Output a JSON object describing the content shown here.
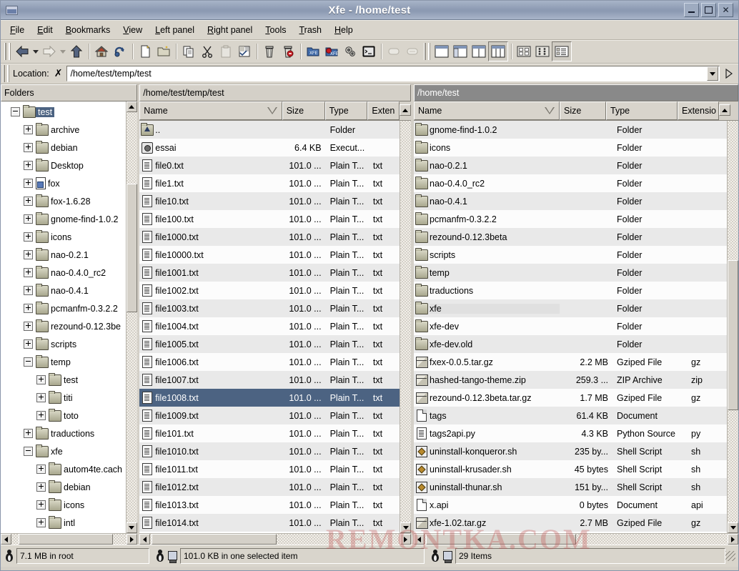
{
  "window": {
    "title": "Xfe - /home/test",
    "app_icon": "xfe-window-icon",
    "minimize_label": "_",
    "maximize_label": "□",
    "close_label": "✕"
  },
  "menubar": {
    "items": [
      {
        "label": "File",
        "accel": "F"
      },
      {
        "label": "Edit",
        "accel": "E"
      },
      {
        "label": "Bookmarks",
        "accel": "B"
      },
      {
        "label": "View",
        "accel": "V"
      },
      {
        "label": "Left panel",
        "accel": "L"
      },
      {
        "label": "Right panel",
        "accel": "R"
      },
      {
        "label": "Tools",
        "accel": "T"
      },
      {
        "label": "Trash",
        "accel": "T"
      },
      {
        "label": "Help",
        "accel": "H"
      }
    ]
  },
  "toolbar": {
    "groups": [
      {
        "buttons": [
          {
            "name": "back-icon",
            "tip": "Back"
          },
          {
            "name": "back-history-dropdown-icon",
            "tip": "Back history"
          },
          {
            "name": "forward-icon",
            "tip": "Forward"
          },
          {
            "name": "forward-history-dropdown-icon",
            "tip": "Forward history"
          },
          {
            "name": "up-icon",
            "tip": "Go up one level"
          }
        ]
      },
      {
        "buttons": [
          {
            "name": "home-icon",
            "tip": "Go home"
          },
          {
            "name": "refresh-icon",
            "tip": "Refresh"
          }
        ]
      },
      {
        "buttons": [
          {
            "name": "new-file-icon",
            "tip": "New file"
          },
          {
            "name": "new-folder-icon",
            "tip": "New folder"
          }
        ]
      },
      {
        "buttons": [
          {
            "name": "copy-icon",
            "tip": "Copy"
          },
          {
            "name": "cut-icon",
            "tip": "Cut"
          },
          {
            "name": "paste-icon",
            "tip": "Paste"
          },
          {
            "name": "properties-icon",
            "tip": "Properties"
          }
        ]
      },
      {
        "buttons": [
          {
            "name": "trash-icon",
            "tip": "Move to trash"
          },
          {
            "name": "delete-icon",
            "tip": "Delete"
          }
        ]
      },
      {
        "buttons": [
          {
            "name": "mount-icon",
            "tip": "Mount"
          },
          {
            "name": "unmount-icon",
            "tip": "Unmount"
          },
          {
            "name": "preferences-icon",
            "tip": "Preferences"
          },
          {
            "name": "terminal-icon",
            "tip": "Open terminal"
          }
        ]
      },
      {
        "buttons": [
          {
            "name": "hidden-files-icon",
            "tip": "Show hidden files"
          },
          {
            "name": "thumbnails-icon",
            "tip": "Show thumbnails"
          }
        ]
      },
      {
        "buttons": [
          {
            "name": "one-panel-icon",
            "tip": "One panel",
            "selected": false
          },
          {
            "name": "tree-and-panel-icon",
            "tip": "Tree and panel",
            "selected": false
          },
          {
            "name": "two-panels-icon",
            "tip": "Two panels",
            "selected": false
          },
          {
            "name": "tree-and-two-panels-icon",
            "tip": "Tree and two panels",
            "selected": true
          }
        ]
      },
      {
        "buttons": [
          {
            "name": "big-icons-view-icon",
            "tip": "Big icons",
            "selected": false
          },
          {
            "name": "small-icons-view-icon",
            "tip": "Small icons",
            "selected": false
          },
          {
            "name": "detailed-list-view-icon",
            "tip": "Detailed file list",
            "selected": true
          }
        ]
      }
    ]
  },
  "location_bar": {
    "label": "Location:",
    "clear_icon": "clear-location-icon",
    "value": "/home/test/temp/test",
    "placeholder": "",
    "dropdown_icon": "chevron-down-icon",
    "go_icon": "go-icon"
  },
  "tree_panel": {
    "header": "Folders",
    "nodes": [
      {
        "label": "test",
        "depth": 0,
        "expander": "minus",
        "icon": "folder-icon",
        "selected": true
      },
      {
        "label": "archive",
        "depth": 1,
        "expander": "plus",
        "icon": "folder-icon",
        "selected": false
      },
      {
        "label": "debian",
        "depth": 1,
        "expander": "plus",
        "icon": "folder-icon",
        "selected": false
      },
      {
        "label": "Desktop",
        "depth": 1,
        "expander": "plus",
        "icon": "folder-icon",
        "selected": false
      },
      {
        "label": "fox",
        "depth": 1,
        "expander": "plus",
        "icon": "link-folder-icon",
        "selected": false
      },
      {
        "label": "fox-1.6.28",
        "depth": 1,
        "expander": "plus",
        "icon": "folder-icon",
        "selected": false
      },
      {
        "label": "gnome-find-1.0.2",
        "depth": 1,
        "expander": "plus",
        "icon": "folder-icon",
        "selected": false
      },
      {
        "label": "icons",
        "depth": 1,
        "expander": "plus",
        "icon": "folder-icon",
        "selected": false
      },
      {
        "label": "nao-0.2.1",
        "depth": 1,
        "expander": "plus",
        "icon": "folder-icon",
        "selected": false
      },
      {
        "label": "nao-0.4.0_rc2",
        "depth": 1,
        "expander": "plus",
        "icon": "folder-icon",
        "selected": false
      },
      {
        "label": "nao-0.4.1",
        "depth": 1,
        "expander": "plus",
        "icon": "folder-icon",
        "selected": false
      },
      {
        "label": "pcmanfm-0.3.2.2",
        "depth": 1,
        "expander": "plus",
        "icon": "folder-icon",
        "selected": false
      },
      {
        "label": "rezound-0.12.3be",
        "depth": 1,
        "expander": "plus",
        "icon": "folder-icon",
        "selected": false
      },
      {
        "label": "scripts",
        "depth": 1,
        "expander": "plus",
        "icon": "folder-icon",
        "selected": false
      },
      {
        "label": "temp",
        "depth": 1,
        "expander": "minus",
        "icon": "folder-icon",
        "selected": false
      },
      {
        "label": "test",
        "depth": 2,
        "expander": "plus",
        "icon": "folder-icon",
        "selected": false
      },
      {
        "label": "titi",
        "depth": 2,
        "expander": "plus",
        "icon": "folder-icon",
        "selected": false
      },
      {
        "label": "toto",
        "depth": 2,
        "expander": "plus",
        "icon": "folder-icon",
        "selected": false
      },
      {
        "label": "traductions",
        "depth": 1,
        "expander": "plus",
        "icon": "folder-icon",
        "selected": false
      },
      {
        "label": "xfe",
        "depth": 1,
        "expander": "minus",
        "icon": "folder-icon",
        "selected": false
      },
      {
        "label": "autom4te.cach",
        "depth": 2,
        "expander": "plus",
        "icon": "folder-icon",
        "selected": false
      },
      {
        "label": "debian",
        "depth": 2,
        "expander": "plus",
        "icon": "folder-icon",
        "selected": false
      },
      {
        "label": "icons",
        "depth": 2,
        "expander": "plus",
        "icon": "folder-icon",
        "selected": false
      },
      {
        "label": "intl",
        "depth": 2,
        "expander": "plus",
        "icon": "folder-icon",
        "selected": false
      }
    ]
  },
  "left_panel": {
    "path": "/home/test/temp/test",
    "active": true,
    "columns": [
      {
        "label": "Name",
        "sorted": true
      },
      {
        "label": "Size",
        "sorted": false
      },
      {
        "label": "Type",
        "sorted": false
      },
      {
        "label": "Exten",
        "sorted": false
      }
    ],
    "rows": [
      {
        "name": "..",
        "size": "",
        "type": "Folder",
        "ext": "",
        "icon": "folder-up-icon",
        "selected": false
      },
      {
        "name": "essai",
        "size": "6.4 KB",
        "type": "Execut...",
        "ext": "",
        "icon": "executable-icon",
        "selected": false
      },
      {
        "name": "file0.txt",
        "size": "101.0 ...",
        "type": "Plain T...",
        "ext": "txt",
        "icon": "text-file-icon",
        "selected": false
      },
      {
        "name": "file1.txt",
        "size": "101.0 ...",
        "type": "Plain T...",
        "ext": "txt",
        "icon": "text-file-icon",
        "selected": false
      },
      {
        "name": "file10.txt",
        "size": "101.0 ...",
        "type": "Plain T...",
        "ext": "txt",
        "icon": "text-file-icon",
        "selected": false
      },
      {
        "name": "file100.txt",
        "size": "101.0 ...",
        "type": "Plain T...",
        "ext": "txt",
        "icon": "text-file-icon",
        "selected": false
      },
      {
        "name": "file1000.txt",
        "size": "101.0 ...",
        "type": "Plain T...",
        "ext": "txt",
        "icon": "text-file-icon",
        "selected": false
      },
      {
        "name": "file10000.txt",
        "size": "101.0 ...",
        "type": "Plain T...",
        "ext": "txt",
        "icon": "text-file-icon",
        "selected": false
      },
      {
        "name": "file1001.txt",
        "size": "101.0 ...",
        "type": "Plain T...",
        "ext": "txt",
        "icon": "text-file-icon",
        "selected": false
      },
      {
        "name": "file1002.txt",
        "size": "101.0 ...",
        "type": "Plain T...",
        "ext": "txt",
        "icon": "text-file-icon",
        "selected": false
      },
      {
        "name": "file1003.txt",
        "size": "101.0 ...",
        "type": "Plain T...",
        "ext": "txt",
        "icon": "text-file-icon",
        "selected": false
      },
      {
        "name": "file1004.txt",
        "size": "101.0 ...",
        "type": "Plain T...",
        "ext": "txt",
        "icon": "text-file-icon",
        "selected": false
      },
      {
        "name": "file1005.txt",
        "size": "101.0 ...",
        "type": "Plain T...",
        "ext": "txt",
        "icon": "text-file-icon",
        "selected": false
      },
      {
        "name": "file1006.txt",
        "size": "101.0 ...",
        "type": "Plain T...",
        "ext": "txt",
        "icon": "text-file-icon",
        "selected": false
      },
      {
        "name": "file1007.txt",
        "size": "101.0 ...",
        "type": "Plain T...",
        "ext": "txt",
        "icon": "text-file-icon",
        "selected": false
      },
      {
        "name": "file1008.txt",
        "size": "101.0 ...",
        "type": "Plain T...",
        "ext": "txt",
        "icon": "text-file-icon",
        "selected": true
      },
      {
        "name": "file1009.txt",
        "size": "101.0 ...",
        "type": "Plain T...",
        "ext": "txt",
        "icon": "text-file-icon",
        "selected": false
      },
      {
        "name": "file101.txt",
        "size": "101.0 ...",
        "type": "Plain T...",
        "ext": "txt",
        "icon": "text-file-icon",
        "selected": false
      },
      {
        "name": "file1010.txt",
        "size": "101.0 ...",
        "type": "Plain T...",
        "ext": "txt",
        "icon": "text-file-icon",
        "selected": false
      },
      {
        "name": "file1011.txt",
        "size": "101.0 ...",
        "type": "Plain T...",
        "ext": "txt",
        "icon": "text-file-icon",
        "selected": false
      },
      {
        "name": "file1012.txt",
        "size": "101.0 ...",
        "type": "Plain T...",
        "ext": "txt",
        "icon": "text-file-icon",
        "selected": false
      },
      {
        "name": "file1013.txt",
        "size": "101.0 ...",
        "type": "Plain T...",
        "ext": "txt",
        "icon": "text-file-icon",
        "selected": false
      },
      {
        "name": "file1014.txt",
        "size": "101.0 ...",
        "type": "Plain T...",
        "ext": "txt",
        "icon": "text-file-icon",
        "selected": false
      }
    ]
  },
  "right_panel": {
    "path": "/home/test",
    "active": false,
    "columns": [
      {
        "label": "Name",
        "sorted": true
      },
      {
        "label": "Size",
        "sorted": false
      },
      {
        "label": "Type",
        "sorted": false
      },
      {
        "label": "Extensio",
        "sorted": false
      }
    ],
    "rows": [
      {
        "name": "gnome-find-1.0.2",
        "size": "",
        "type": "Folder",
        "ext": "",
        "icon": "folder-icon",
        "focused": false
      },
      {
        "name": "icons",
        "size": "",
        "type": "Folder",
        "ext": "",
        "icon": "folder-icon",
        "focused": false
      },
      {
        "name": "nao-0.2.1",
        "size": "",
        "type": "Folder",
        "ext": "",
        "icon": "folder-icon",
        "focused": false
      },
      {
        "name": "nao-0.4.0_rc2",
        "size": "",
        "type": "Folder",
        "ext": "",
        "icon": "folder-icon",
        "focused": false
      },
      {
        "name": "nao-0.4.1",
        "size": "",
        "type": "Folder",
        "ext": "",
        "icon": "folder-icon",
        "focused": false
      },
      {
        "name": "pcmanfm-0.3.2.2",
        "size": "",
        "type": "Folder",
        "ext": "",
        "icon": "folder-icon",
        "focused": false
      },
      {
        "name": "rezound-0.12.3beta",
        "size": "",
        "type": "Folder",
        "ext": "",
        "icon": "folder-icon",
        "focused": false
      },
      {
        "name": "scripts",
        "size": "",
        "type": "Folder",
        "ext": "",
        "icon": "folder-icon",
        "focused": false
      },
      {
        "name": "temp",
        "size": "",
        "type": "Folder",
        "ext": "",
        "icon": "folder-icon",
        "focused": false
      },
      {
        "name": "traductions",
        "size": "",
        "type": "Folder",
        "ext": "",
        "icon": "folder-icon",
        "focused": false
      },
      {
        "name": "xfe",
        "size": "",
        "type": "Folder",
        "ext": "",
        "icon": "folder-icon",
        "focused": true
      },
      {
        "name": "xfe-dev",
        "size": "",
        "type": "Folder",
        "ext": "",
        "icon": "folder-icon",
        "focused": false
      },
      {
        "name": "xfe-dev.old",
        "size": "",
        "type": "Folder",
        "ext": "",
        "icon": "folder-icon",
        "focused": false
      },
      {
        "name": "fxex-0.0.5.tar.gz",
        "size": "2.2 MB",
        "type": "Gziped File",
        "ext": "gz",
        "icon": "archive-icon",
        "focused": false
      },
      {
        "name": "hashed-tango-theme.zip",
        "size": "259.3 ...",
        "type": "ZIP Archive",
        "ext": "zip",
        "icon": "archive-icon",
        "focused": false
      },
      {
        "name": "rezound-0.12.3beta.tar.gz",
        "size": "1.7 MB",
        "type": "Gziped File",
        "ext": "gz",
        "icon": "archive-icon",
        "focused": false
      },
      {
        "name": "tags",
        "size": "61.4 KB",
        "type": "Document",
        "ext": "",
        "icon": "document-icon",
        "focused": false
      },
      {
        "name": "tags2api.py",
        "size": "4.3 KB",
        "type": "Python Source",
        "ext": "py",
        "icon": "text-file-icon",
        "focused": false
      },
      {
        "name": "uninstall-konqueror.sh",
        "size": "235 by...",
        "type": "Shell Script",
        "ext": "sh",
        "icon": "shell-script-icon",
        "focused": false
      },
      {
        "name": "uninstall-krusader.sh",
        "size": "45 bytes",
        "type": "Shell Script",
        "ext": "sh",
        "icon": "shell-script-icon",
        "focused": false
      },
      {
        "name": "uninstall-thunar.sh",
        "size": "151 by...",
        "type": "Shell Script",
        "ext": "sh",
        "icon": "shell-script-icon",
        "focused": false
      },
      {
        "name": "x.api",
        "size": "0 bytes",
        "type": "Document",
        "ext": "api",
        "icon": "document-icon",
        "focused": false
      },
      {
        "name": "xfe-1.02.tar.gz",
        "size": "2.7 MB",
        "type": "Gziped File",
        "ext": "gz",
        "icon": "archive-icon",
        "focused": false
      }
    ]
  },
  "statusbar": {
    "tree_status": "7.1 MB in root",
    "left_status": "101.0 KB in one selected item",
    "right_status": "29 Items"
  },
  "watermark": {
    "text": "REMONTKA.COM"
  }
}
